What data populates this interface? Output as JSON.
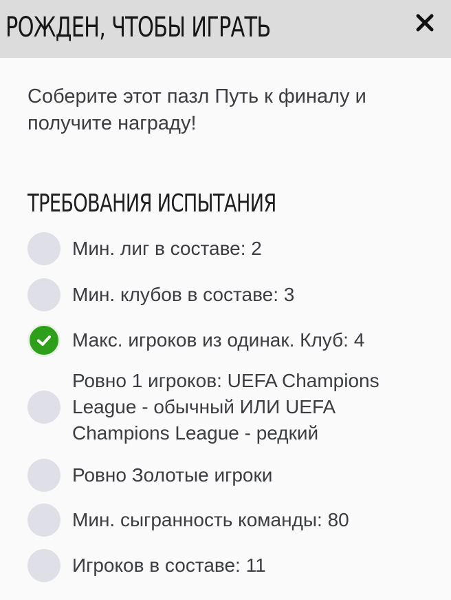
{
  "header": {
    "title": "РОЖДЕН, ЧТОБЫ ИГРАТЬ",
    "close_icon": "close-icon"
  },
  "intro_text": "Соберите этот пазл Путь к финалу и получите награду!",
  "requirements": {
    "title": "ТРЕБОВАНИЯ ИСПЫТАНИЯ",
    "items": [
      {
        "label": "Мин. лиг в составе: 2",
        "completed": false
      },
      {
        "label": "Мин. клубов в составе: 3",
        "completed": false
      },
      {
        "label": "Макс. игроков из одинак. Клуб: 4",
        "completed": true
      },
      {
        "label": "Ровно 1 игроков: UEFA Champions League - обычный ИЛИ UEFA Champions League - редкий",
        "completed": false
      },
      {
        "label": "Ровно Золотые игроки",
        "completed": false
      },
      {
        "label": "Мин. сыгранность команды: 80",
        "completed": false
      },
      {
        "label": "Игроков в составе: 11",
        "completed": false
      }
    ]
  },
  "colors": {
    "completed": "#2e9f1b",
    "pending": "#dfdfe7",
    "header_bg": "#dcdcdc"
  }
}
